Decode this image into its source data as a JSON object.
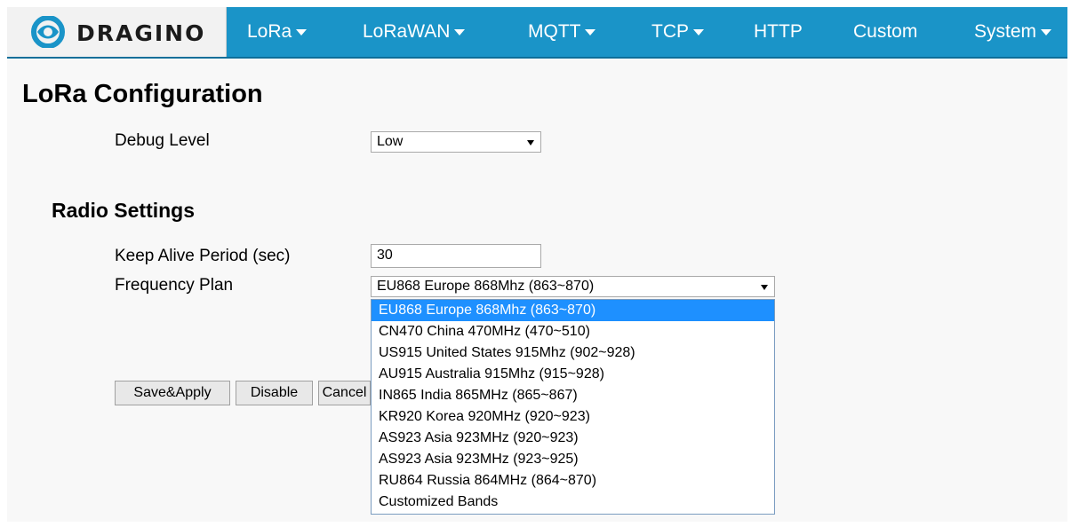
{
  "brand": {
    "name": "DRAGINO"
  },
  "nav": {
    "items": [
      {
        "label": "LoRa",
        "has_menu": true
      },
      {
        "label": "LoRaWAN",
        "has_menu": true
      },
      {
        "label": "MQTT",
        "has_menu": true
      },
      {
        "label": "TCP",
        "has_menu": true
      },
      {
        "label": "HTTP",
        "has_menu": false
      },
      {
        "label": "Custom",
        "has_menu": false
      },
      {
        "label": "System",
        "has_menu": true
      }
    ]
  },
  "page": {
    "title": "LoRa Configuration",
    "debug_level_label": "Debug Level",
    "debug_level_value": "Low",
    "radio_settings_title": "Radio Settings",
    "keep_alive_label": "Keep Alive Period (sec)",
    "keep_alive_value": "30",
    "frequency_plan_label": "Frequency Plan",
    "frequency_plan_value": "EU868 Europe 868Mhz (863~870)"
  },
  "frequency_options": [
    "EU868 Europe 868Mhz (863~870)",
    "CN470 China 470MHz (470~510)",
    "US915 United States 915Mhz (902~928)",
    "AU915 Australia 915Mhz (915~928)",
    "IN865 India 865MHz (865~867)",
    "KR920 Korea 920MHz (920~923)",
    "AS923 Asia 923MHz (920~923)",
    "AS923 Asia 923MHz (923~925)",
    "RU864 Russia 864MHz (864~870)",
    "Customized Bands"
  ],
  "selected_option_index": 0,
  "buttons": {
    "save_apply": "Save&Apply",
    "disable": "Disable",
    "cancel": "Cancel"
  },
  "colors": {
    "nav_bg": "#1a94c8",
    "selected_bg": "#1e90ff"
  }
}
